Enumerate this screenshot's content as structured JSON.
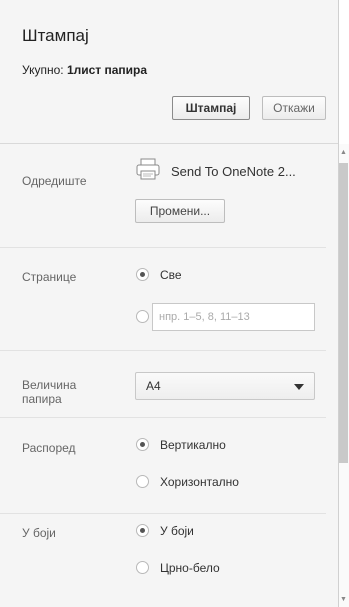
{
  "header": {
    "title": "Штампај",
    "total_label": "Укупно: ",
    "total_value": "1лист папира",
    "print_button": "Штампај",
    "cancel_button": "Откажи"
  },
  "destination": {
    "label": "Одредиште",
    "printer_name": "Send To OneNote 2...",
    "change_button": "Промени..."
  },
  "pages": {
    "label": "Странице",
    "all_label": "Све",
    "custom_placeholder": "нпр. 1–5, 8, 11–13",
    "selected": "all"
  },
  "paper_size": {
    "label_line1": "Величина",
    "label_line2": "папира",
    "value": "A4"
  },
  "layout": {
    "label": "Распоред",
    "portrait_label": "Вертикално",
    "landscape_label": "Хоризонтално",
    "selected": "portrait"
  },
  "color": {
    "label": "У боји",
    "color_label": "У боји",
    "bw_label": "Црно-бело",
    "selected": "color"
  },
  "icons": {
    "printer": "printer-icon",
    "dropdown": "chevron-down-icon"
  }
}
